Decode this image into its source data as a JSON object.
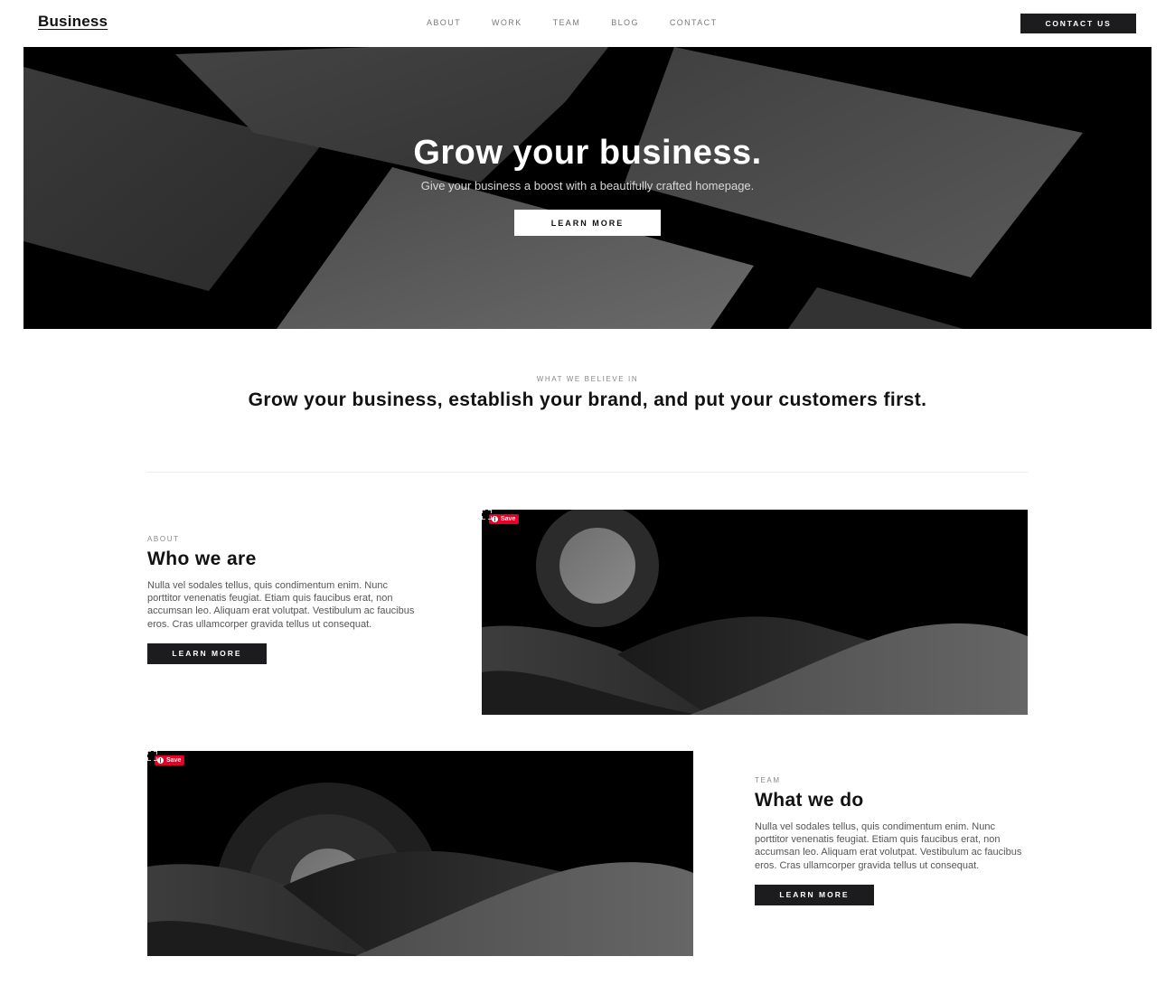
{
  "header": {
    "logo": "Business",
    "nav": [
      "ABOUT",
      "WORK",
      "TEAM",
      "BLOG",
      "CONTACT"
    ],
    "cta": "CONTACT US"
  },
  "hero": {
    "title": "Grow your business.",
    "subtitle": "Give your business a boost with a beautifully crafted homepage.",
    "button": "LEARN MORE"
  },
  "beliefs": {
    "eyebrow": "WHAT WE BELIEVE IN",
    "heading": "Grow your business, establish your brand, and put your customers first."
  },
  "features": [
    {
      "eyebrow": "ABOUT",
      "title": "Who we are",
      "body": "Nulla vel sodales tellus, quis condimentum enim. Nunc porttitor venenatis feugiat. Etiam quis faucibus erat, non accumsan leo. Aliquam erat volutpat. Vestibulum ac faucibus eros. Cras ullamcorper gravida tellus ut consequat.",
      "button": "LEARN MORE",
      "save_label": "Save",
      "image_icon": "landscape-illustration"
    },
    {
      "eyebrow": "TEAM",
      "title": "What we do",
      "body": "Nulla vel sodales tellus, quis condimentum enim. Nunc porttitor venenatis feugiat. Etiam quis faucibus erat, non accumsan leo. Aliquam erat volutpat. Vestibulum ac faucibus eros. Cras ullamcorper gravida tellus ut consequat.",
      "button": "LEARN MORE",
      "save_label": "Save",
      "image_icon": "landscape-illustration"
    }
  ],
  "colors": {
    "dark": "#1c1c1f",
    "pinterest_red": "#e60023",
    "muted_text": "#555555"
  }
}
